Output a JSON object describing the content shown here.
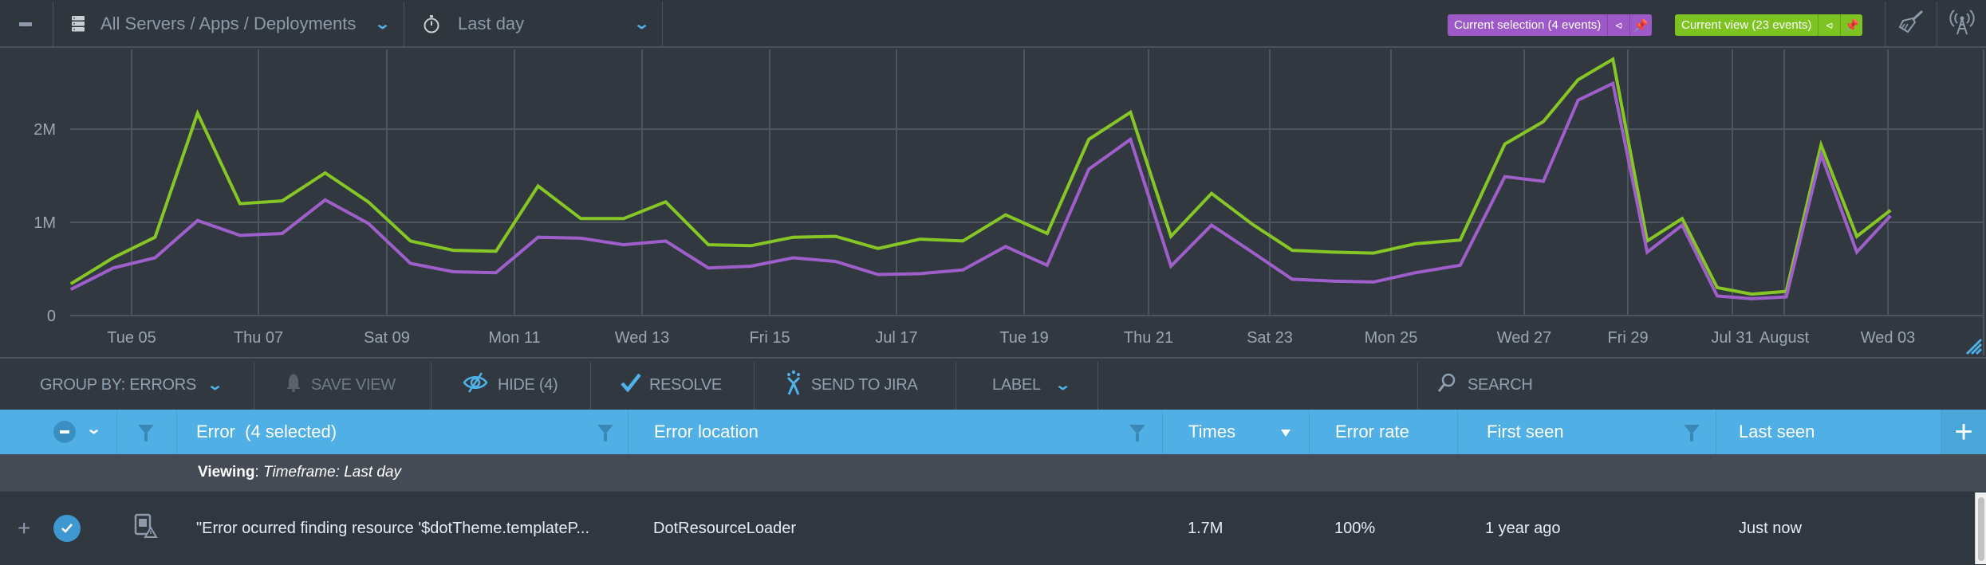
{
  "topbar": {
    "collapse_icon": "minus-icon",
    "scope_icon": "server-stack-icon",
    "scope_label": "All Servers / Apps / Deployments",
    "time_icon": "stopwatch-icon",
    "time_label": "Last day",
    "selection_badge": {
      "label": "Current selection (4 events)",
      "color": "#9e59c9",
      "icons": [
        "share-icon",
        "pin-icon"
      ]
    },
    "view_badge": {
      "label": "Current view (23 events)",
      "color": "#7dc422",
      "icons": [
        "share-icon",
        "pin-icon"
      ]
    },
    "right_icons": [
      "broom-icon",
      "broadcast-tower-icon"
    ]
  },
  "chart_data": {
    "type": "line",
    "title": "",
    "xlabel": "",
    "ylabel": "",
    "yticks": [
      {
        "value": 0,
        "label": "0"
      },
      {
        "value": 1000000,
        "label": "1M"
      },
      {
        "value": 2000000,
        "label": "2M"
      }
    ],
    "ylim": [
      0,
      2900000
    ],
    "grid": true,
    "xticks": [
      {
        "day": 5,
        "label": "Tue 05"
      },
      {
        "day": 7,
        "label": "Thu 07"
      },
      {
        "day": 9,
        "label": "Sat 09"
      },
      {
        "day": 11,
        "label": "Mon 11"
      },
      {
        "day": 13,
        "label": "Wed 13"
      },
      {
        "day": 15,
        "label": "Fri 15"
      },
      {
        "day": 17,
        "label": "Jul 17"
      },
      {
        "day": 19,
        "label": "Tue 19"
      },
      {
        "day": 21,
        "label": "Thu 21"
      },
      {
        "day": 23,
        "label": "Sat 23"
      },
      {
        "day": 25,
        "label": "Mon 25"
      },
      {
        "day": 27,
        "label": "Wed 27"
      },
      {
        "day": 29,
        "label": "Fri 29"
      },
      {
        "day": 31,
        "label": "Jul 31"
      },
      {
        "day": 32,
        "label": "August"
      },
      {
        "day": 34,
        "label": "Wed 03"
      }
    ],
    "x_unit": "day of July (fractional); Aug 1 = 32",
    "x": [
      4.04,
      4.71,
      5.37,
      6.04,
      6.71,
      7.37,
      8.04,
      8.71,
      9.37,
      10.04,
      10.71,
      11.37,
      12.04,
      12.71,
      13.37,
      14.04,
      14.71,
      15.37,
      16.04,
      16.71,
      17.37,
      18.04,
      18.71,
      19.37,
      20.04,
      20.71,
      21.37,
      22.04,
      22.71,
      23.37,
      24.04,
      24.71,
      25.37,
      26.04,
      26.71,
      27.37,
      28.04,
      28.71,
      29.37,
      30.04,
      30.71,
      31.37,
      32.04,
      32.71,
      33.4,
      34.05
    ],
    "series": [
      {
        "name": "Current view (23 events)",
        "color": "#86c726",
        "values": [
          340000,
          620000,
          840000,
          2170000,
          1200000,
          1230000,
          1530000,
          1220000,
          800000,
          700000,
          690000,
          1390000,
          1040000,
          1040000,
          1220000,
          760000,
          750000,
          840000,
          850000,
          720000,
          820000,
          800000,
          1080000,
          880000,
          1890000,
          2180000,
          850000,
          1310000,
          980000,
          700000,
          680000,
          670000,
          770000,
          810000,
          1840000,
          2080000,
          2530000,
          2750000,
          800000,
          1040000,
          300000,
          230000,
          260000,
          1830000,
          850000,
          1130000
        ]
      },
      {
        "name": "Current selection (4 events)",
        "color": "#9e5fca",
        "values": [
          280000,
          510000,
          620000,
          1020000,
          860000,
          880000,
          1240000,
          990000,
          560000,
          470000,
          460000,
          840000,
          830000,
          760000,
          800000,
          510000,
          530000,
          620000,
          580000,
          440000,
          450000,
          490000,
          740000,
          540000,
          1570000,
          1890000,
          530000,
          970000,
          680000,
          390000,
          370000,
          360000,
          460000,
          540000,
          1490000,
          1440000,
          2310000,
          2490000,
          680000,
          970000,
          210000,
          180000,
          200000,
          1730000,
          680000,
          1070000
        ]
      }
    ]
  },
  "toolbar": {
    "group_by_label": "GROUP BY: ERRORS",
    "save_view_label": "SAVE VIEW",
    "hide_label": "HIDE (4)",
    "resolve_label": "RESOLVE",
    "send_to_jira_label": "SEND TO JIRA",
    "label_label": "LABEL",
    "search_placeholder": "SEARCH"
  },
  "table": {
    "columns": [
      {
        "label": "Error  (4 selected)",
        "filter": true
      },
      {
        "label": "Error location",
        "filter": true
      },
      {
        "label": "Times",
        "sort": "desc"
      },
      {
        "label": "Error rate"
      },
      {
        "label": "First seen",
        "filter": true
      },
      {
        "label": "Last seen"
      }
    ],
    "viewing_prefix": "Viewing",
    "viewing_value": "Timeframe: Last day",
    "rows": [
      {
        "selected": true,
        "error": "\"Error ocurred finding resource '$dotTheme.templateP...",
        "location": "DotResourceLoader",
        "times": "1.7M",
        "error_rate": "100%",
        "first_seen": "1 year ago",
        "last_seen": "Just now"
      }
    ]
  }
}
